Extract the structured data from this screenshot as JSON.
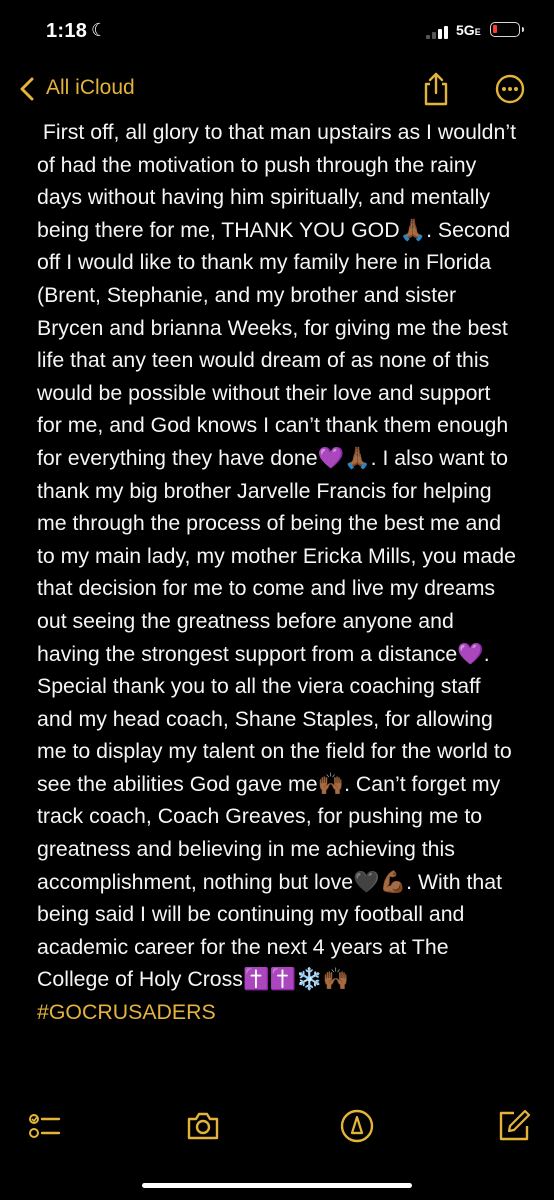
{
  "status": {
    "time": "1:18",
    "network": "5G",
    "network_suffix": "E"
  },
  "nav": {
    "back_label": "All iCloud"
  },
  "note": {
    "body": " First off, all glory to that man upstairs as I wouldn’t of had the motivation to push through the rainy days without having him spiritually, and mentally being there for me, THANK YOU GOD🙏🏾. Second off I would like to thank my family here in Florida (Brent, Stephanie, and my brother and sister Brycen and brianna Weeks, for giving me the best life that any teen would dream of as none of this would be possible without their love and support for me, and God knows I can’t thank them enough for everything they have done💜🙏🏾. I also want to thank my big brother Jarvelle Francis for helping me through the process of being the best me and to my main lady, my mother Ericka Mills, you made that decision for me to come and live my dreams out seeing the greatness before anyone and having the strongest support from a distance💜. Special thank you to all the viera coaching staff and my head coach, Shane Staples, for allowing me to display my talent on the field for the world to see the abilities God gave me🙌🏾. Can’t forget my track coach, Coach Greaves, for pushing me to greatness and believing in me achieving this accomplishment, nothing but love🖤💪🏾. With that being said I will be continuing my football and academic career for the next 4 years at The College of Holy Cross✝️✝️❄️🙌🏾",
    "hashtag": "#GOCRUSADERS"
  },
  "icons": {
    "back": "chevron-left-icon",
    "share": "share-icon",
    "more": "ellipsis-circle-icon",
    "checklist": "checklist-icon",
    "camera": "camera-icon",
    "markup": "markup-pen-icon",
    "compose": "compose-icon"
  },
  "colors": {
    "accent": "#e3b33b",
    "background": "#000000",
    "text": "#f5f5f5",
    "battery_low": "#ff3b30"
  }
}
